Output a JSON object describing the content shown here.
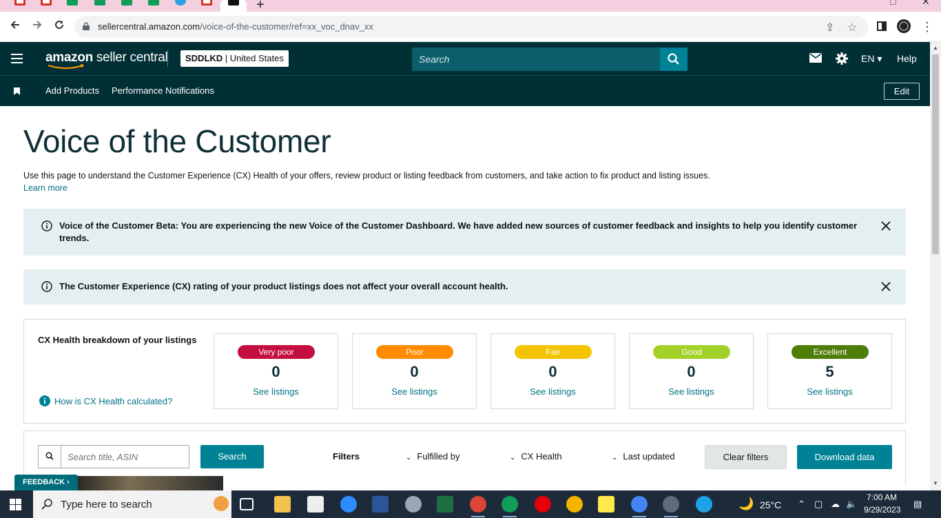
{
  "browser": {
    "url_host": "sellercentral.amazon.com",
    "url_path": "/voice-of-the-customer/ref=xx_voc_dnav_xx",
    "tabs": [
      {
        "icon": "gmail-icon",
        "color": "#d93025"
      },
      {
        "icon": "gmail-icon",
        "color": "#d93025"
      },
      {
        "icon": "sheets-icon",
        "color": "#0f9d58"
      },
      {
        "icon": "sheets-icon",
        "color": "#0f9d58"
      },
      {
        "icon": "sheets-icon",
        "color": "#0f9d58"
      },
      {
        "icon": "sheets-icon",
        "color": "#0f9d58"
      },
      {
        "icon": "telegram-icon",
        "color": "#2aa3e0"
      },
      {
        "icon": "gmail-icon",
        "color": "#d93025"
      },
      {
        "icon": "amazon-icon",
        "color": "#111111"
      }
    ]
  },
  "header": {
    "logo_bold": "amazon",
    "logo_rest": " seller central",
    "account_name": "SDDLKD",
    "account_region": " | United States",
    "search_placeholder": "Search",
    "language": "EN",
    "help": "Help"
  },
  "subnav": {
    "links": [
      "Add Products",
      "Performance Notifications"
    ],
    "edit": "Edit"
  },
  "page": {
    "title": "Voice of the Customer",
    "intro": "Use this page to understand the Customer Experience (CX) Health of your offers, review product or listing feedback from customers, and take action to fix product and listing issues.",
    "learn_more": "Learn more"
  },
  "alerts": [
    {
      "text": "Voice of the Customer Beta: You are experiencing the new Voice of the Customer Dashboard. We have added new sources of customer feedback and insights to help you identify customer trends."
    },
    {
      "text": "The Customer Experience (CX) rating of your product listings does not affect your overall account health."
    }
  ],
  "cx_health": {
    "heading": "CX Health breakdown of your listings",
    "how_link": "How is CX Health calculated?",
    "tiles": [
      {
        "label": "Very poor",
        "count": "0",
        "link": "See listings",
        "color": "#c40e3f"
      },
      {
        "label": "Poor",
        "count": "0",
        "link": "See listings",
        "color": "#ff8c00"
      },
      {
        "label": "Fair",
        "count": "0",
        "link": "See listings",
        "color": "#f5c400"
      },
      {
        "label": "Good",
        "count": "0",
        "link": "See listings",
        "color": "#a2d22a"
      },
      {
        "label": "Excellent",
        "count": "5",
        "link": "See listings",
        "color": "#4f7d0a"
      }
    ]
  },
  "filters": {
    "search_placeholder": "Search title, ASIN",
    "search_button": "Search",
    "label": "Filters",
    "dropdowns": [
      "Fulfilled by",
      "CX Health",
      "Last updated"
    ],
    "clear": "Clear filters",
    "download": "Download data"
  },
  "feedback_tab": "FEEDBACK",
  "taskbar": {
    "search_placeholder": "Type here to search",
    "temperature": "25°C",
    "time": "7:00 AM",
    "date": "9/29/2023"
  },
  "colors": {
    "header_bg": "#002f36",
    "teal": "#008296",
    "link": "#007185"
  }
}
